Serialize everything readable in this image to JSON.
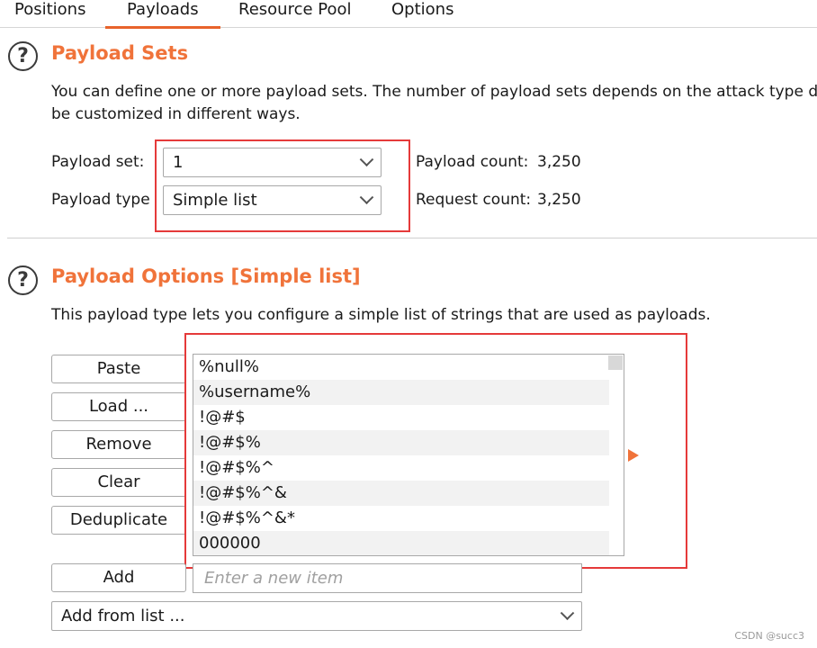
{
  "tabs": [
    "Positions",
    "Payloads",
    "Resource Pool",
    "Options"
  ],
  "payload_sets": {
    "title": "Payload Sets",
    "description_line1": "You can define one or more payload sets. The number of payload sets depends on the attack type d",
    "description_line2": "be customized in different ways.",
    "set_label": "Payload set:",
    "set_value": "1",
    "type_label": "Payload type",
    "type_value": "Simple list",
    "payload_count_label": "Payload count:",
    "payload_count": "3,250",
    "request_count_label": "Request count:",
    "request_count": "3,250"
  },
  "payload_options": {
    "title": "Payload Options [Simple list]",
    "description": "This payload type lets you configure a simple list of strings that are used as payloads.",
    "buttons": {
      "paste": "Paste",
      "load": "Load ...",
      "remove": "Remove",
      "clear": "Clear",
      "deduplicate": "Deduplicate",
      "add": "Add"
    },
    "items": [
      "%null%",
      "%username%",
      "!@#$",
      "!@#$%",
      "!@#$%^",
      "!@#$%^&",
      "!@#$%^&*",
      "000000"
    ],
    "new_item_placeholder": "Enter a new item",
    "add_from_list": "Add from list ..."
  },
  "watermark": "CSDN @succ3",
  "colors": {
    "accent": "#f0733a",
    "highlight_box": "#e53a3a"
  }
}
